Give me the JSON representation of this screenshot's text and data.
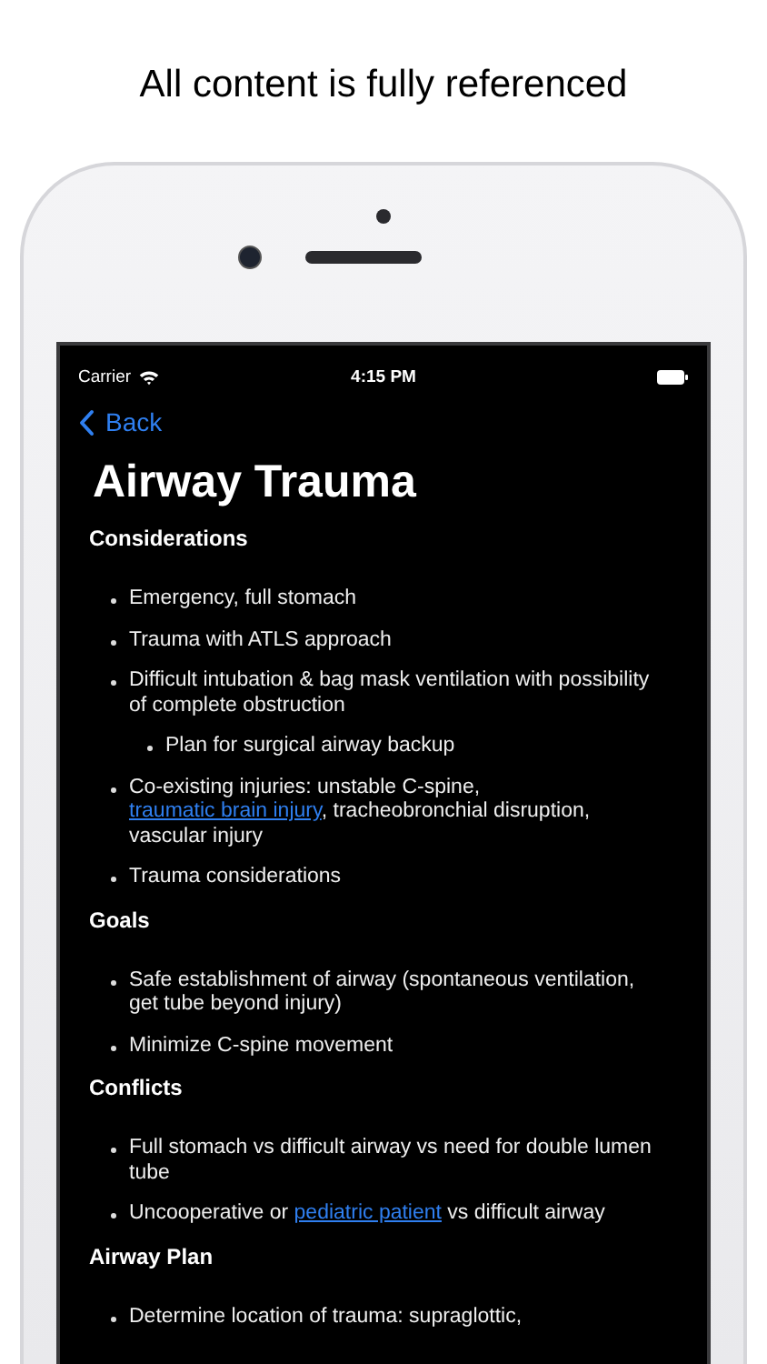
{
  "headline": "All content is fully referenced",
  "status_bar": {
    "carrier": "Carrier",
    "time": "4:15 PM"
  },
  "nav": {
    "back": "Back"
  },
  "title": "Airway Trauma",
  "sections": [
    {
      "heading": "Considerations",
      "items": [
        {
          "parts": [
            {
              "text": "Emergency, full stomach",
              "link": false
            }
          ]
        },
        {
          "parts": [
            {
              "text": "Trauma with ATLS approach",
              "link": false
            }
          ]
        },
        {
          "parts": [
            {
              "text": "Difficult intubation & bag mask ventilation with possibility of complete obstruction",
              "link": false
            }
          ],
          "children": [
            {
              "parts": [
                {
                  "text": "Plan for surgical airway backup",
                  "link": false
                }
              ]
            }
          ]
        },
        {
          "parts": [
            {
              "text": "Co-existing injuries: unstable C-spine, ",
              "link": false
            },
            {
              "text": "traumatic brain injury",
              "link": true
            },
            {
              "text": ", tracheobronchial disruption, vascular injury",
              "link": false
            }
          ]
        },
        {
          "parts": [
            {
              "text": "Trauma considerations",
              "link": false
            }
          ]
        }
      ]
    },
    {
      "heading": "Goals",
      "items": [
        {
          "parts": [
            {
              "text": "Safe establishment of airway (spontaneous ventilation, get tube beyond injury)",
              "link": false
            }
          ]
        },
        {
          "parts": [
            {
              "text": "Minimize C-spine movement",
              "link": false
            }
          ]
        }
      ]
    },
    {
      "heading": "Conflicts",
      "items": [
        {
          "parts": [
            {
              "text": "Full stomach vs difficult airway vs need for double lumen tube",
              "link": false
            }
          ]
        },
        {
          "parts": [
            {
              "text": "Uncooperative or ",
              "link": false
            },
            {
              "text": "pediatric patient",
              "link": true
            },
            {
              "text": " vs difficult airway",
              "link": false
            }
          ]
        }
      ]
    },
    {
      "heading": "Airway Plan",
      "items": [
        {
          "parts": [
            {
              "text": "Determine location of trauma: supraglottic,",
              "link": false
            }
          ]
        }
      ]
    }
  ]
}
